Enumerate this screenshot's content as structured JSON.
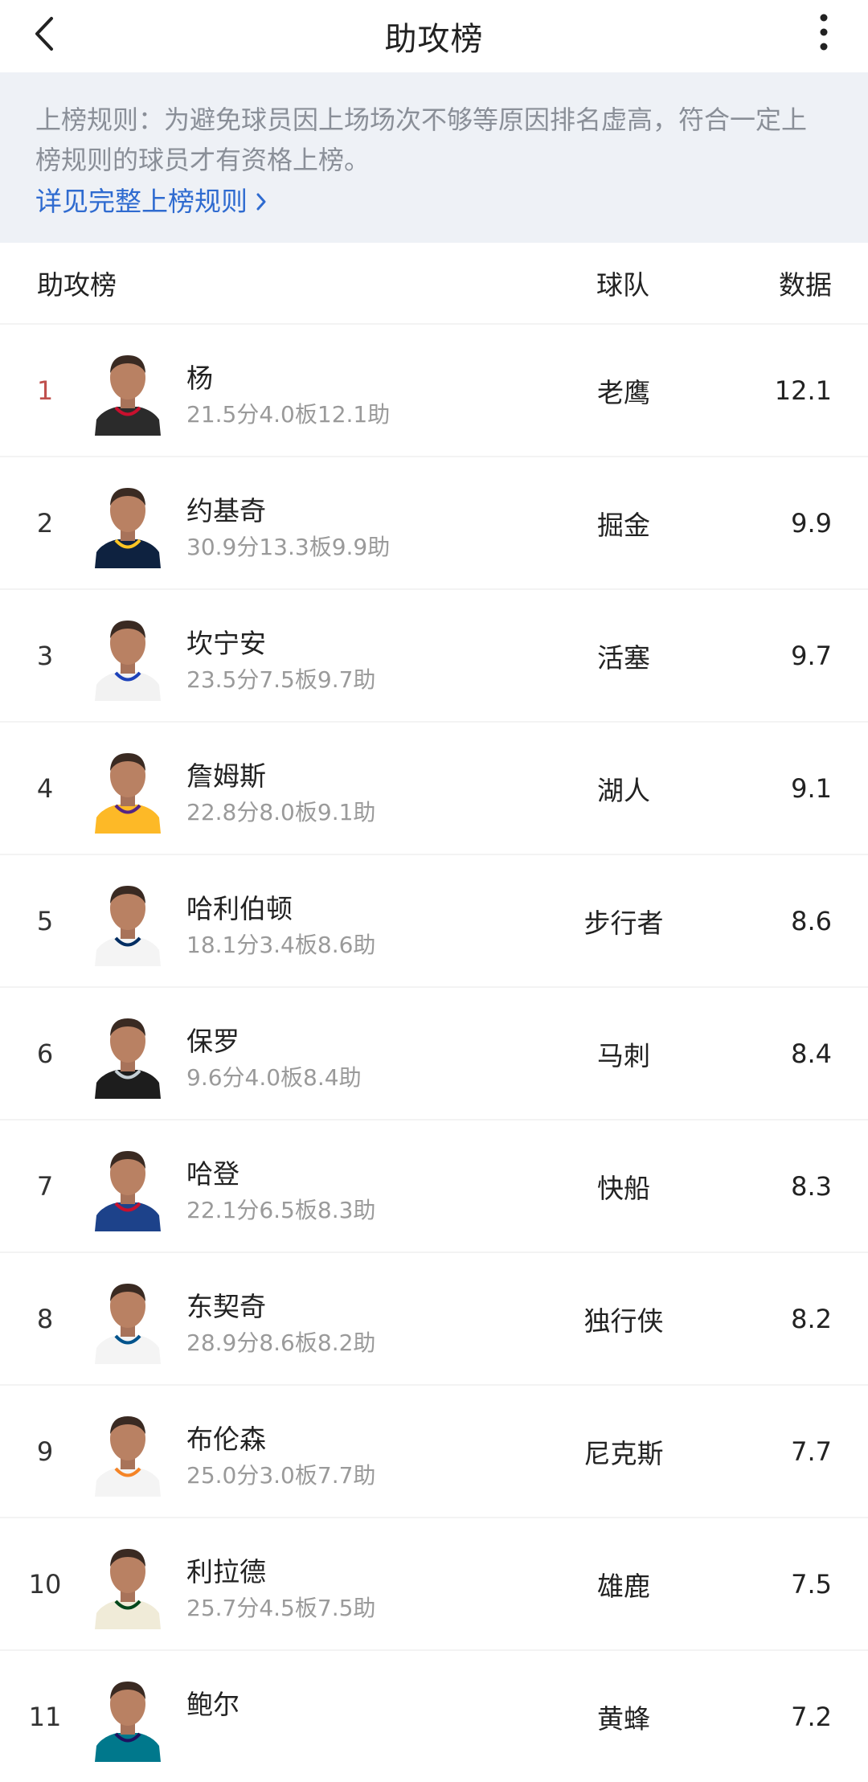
{
  "header": {
    "title": "助攻榜"
  },
  "rules": {
    "text": "上榜规则：为避免球员因上场场次不够等原因排名虚高，符合一定上榜规则的球员才有资格上榜。",
    "link": "详见完整上榜规则"
  },
  "table": {
    "col_name": "助攻榜",
    "col_team": "球队",
    "col_data": "数据"
  },
  "players": [
    {
      "rank": "1",
      "name": "杨",
      "stat": "21.5分4.0板12.1助",
      "team": "老鹰",
      "value": "12.1",
      "jersey": "#2b2b2b",
      "trim": "#c8102e"
    },
    {
      "rank": "2",
      "name": "约基奇",
      "stat": "30.9分13.3板9.9助",
      "team": "掘金",
      "value": "9.9",
      "jersey": "#0e2240",
      "trim": "#fec524"
    },
    {
      "rank": "3",
      "name": "坎宁安",
      "stat": "23.5分7.5板9.7助",
      "team": "活塞",
      "value": "9.7",
      "jersey": "#f2f2f2",
      "trim": "#1d42ba"
    },
    {
      "rank": "4",
      "name": "詹姆斯",
      "stat": "22.8分8.0板9.1助",
      "team": "湖人",
      "value": "9.1",
      "jersey": "#fdb927",
      "trim": "#552583"
    },
    {
      "rank": "5",
      "name": "哈利伯顿",
      "stat": "18.1分3.4板8.6助",
      "team": "步行者",
      "value": "8.6",
      "jersey": "#f4f4f4",
      "trim": "#002d62"
    },
    {
      "rank": "6",
      "name": "保罗",
      "stat": "9.6分4.0板8.4助",
      "team": "马刺",
      "value": "8.4",
      "jersey": "#1d1d1d",
      "trim": "#c4ced4"
    },
    {
      "rank": "7",
      "name": "哈登",
      "stat": "22.1分6.5板8.3助",
      "team": "快船",
      "value": "8.3",
      "jersey": "#1d428a",
      "trim": "#c8102e"
    },
    {
      "rank": "8",
      "name": "东契奇",
      "stat": "28.9分8.6板8.2助",
      "team": "独行侠",
      "value": "8.2",
      "jersey": "#f4f4f4",
      "trim": "#00538c"
    },
    {
      "rank": "9",
      "name": "布伦森",
      "stat": "25.0分3.0板7.7助",
      "team": "尼克斯",
      "value": "7.7",
      "jersey": "#f4f4f4",
      "trim": "#f58426"
    },
    {
      "rank": "10",
      "name": "利拉德",
      "stat": "25.7分4.5板7.5助",
      "team": "雄鹿",
      "value": "7.5",
      "jersey": "#f0ebd8",
      "trim": "#00471b"
    },
    {
      "rank": "11",
      "name": "鲍尔",
      "stat": "",
      "team": "黄蜂",
      "value": "7.2",
      "jersey": "#00788c",
      "trim": "#1d1160"
    }
  ],
  "colors": {
    "link": "#2f6bd0",
    "rank_top": "#c0504d",
    "rules_bg": "#eef1f6",
    "muted": "#9a9a9a"
  },
  "icons": {
    "back": "chevron-left-icon",
    "more": "more-vertical-icon",
    "link": "chevron-right-icon"
  }
}
